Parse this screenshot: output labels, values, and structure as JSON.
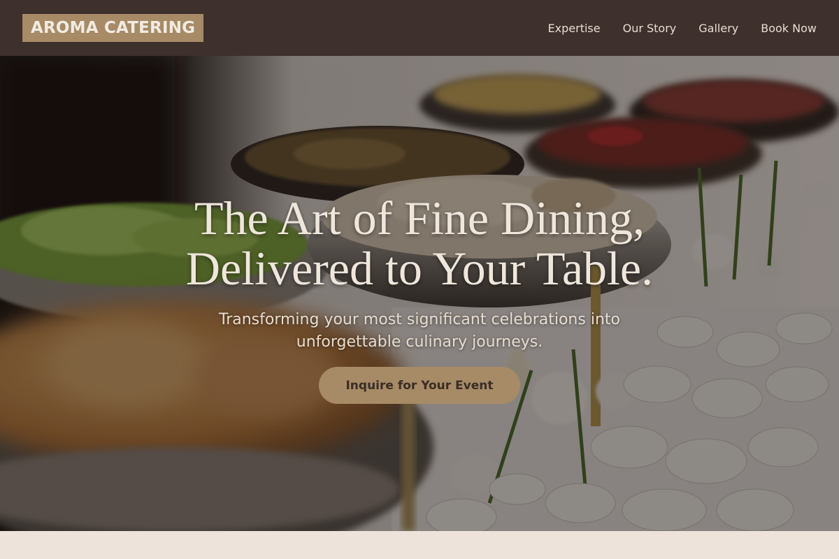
{
  "header": {
    "logo": "AROMA CATERING",
    "nav": [
      {
        "label": "Expertise"
      },
      {
        "label": "Our Story"
      },
      {
        "label": "Gallery"
      },
      {
        "label": "Book Now"
      }
    ]
  },
  "hero": {
    "title_line1": "The Art of Fine Dining,",
    "title_line2": "Delivered to Your Table.",
    "subtitle_line1": "Transforming your most significant celebrations into",
    "subtitle_line2": "unforgettable culinary journeys.",
    "cta_label": "Inquire for Your Event",
    "background_image": "catering-buffet-photo"
  },
  "colors": {
    "nav_background": "#3e302c",
    "accent": "#a68b66",
    "page_background": "#ede3da"
  }
}
